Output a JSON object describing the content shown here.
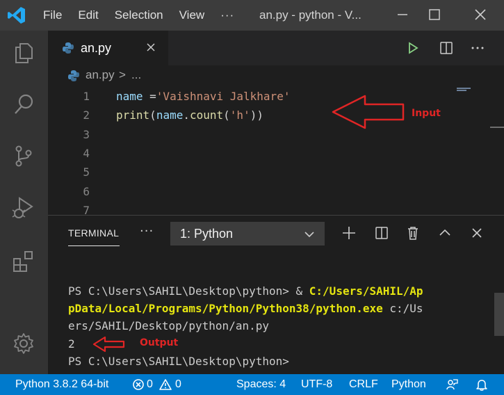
{
  "titlebar": {
    "menu": [
      "File",
      "Edit",
      "Selection",
      "View",
      "···"
    ],
    "window_title": "an.py - python - V..."
  },
  "tab": {
    "label": "an.py"
  },
  "breadcrumb": {
    "file": "an.py",
    "separator": ">",
    "more": "..."
  },
  "editor": {
    "line_numbers": [
      "1",
      "2",
      "3",
      "4",
      "5",
      "6",
      "7"
    ],
    "line1": {
      "var": "name",
      "op": " =",
      "str": "'Vaishnavi Jalkhare'"
    },
    "line2": {
      "fn": "print",
      "p1": "(",
      "var": "name",
      "dot": ".",
      "method": "count",
      "p2": "(",
      "str": "'h'",
      "p3": "))"
    }
  },
  "annotations": {
    "input_label": "Input",
    "output_label": "Output",
    "color": "#e02525"
  },
  "panel": {
    "tab_label": "TERMINAL",
    "more": "···",
    "terminal_select": "1: Python",
    "lines": {
      "l1_prompt": "PS C:\\Users\\SAHIL\\Desktop\\python> & ",
      "l1_path": "C:/Users/SAHIL/Ap",
      "l2_path": "pData/Local/Programs/Python/Python38/python.exe",
      "l2_arg": " c:/Us",
      "l3": "ers/SAHIL/Desktop/python/an.py",
      "l4": "2",
      "l5": "PS C:\\Users\\SAHIL\\Desktop\\python>"
    }
  },
  "statusbar": {
    "interpreter": "Python 3.8.2 64-bit",
    "errors": "0",
    "warnings": "0",
    "spaces": "Spaces: 4",
    "encoding": "UTF-8",
    "eol": "CRLF",
    "language": "Python",
    "color": "#007acc"
  }
}
